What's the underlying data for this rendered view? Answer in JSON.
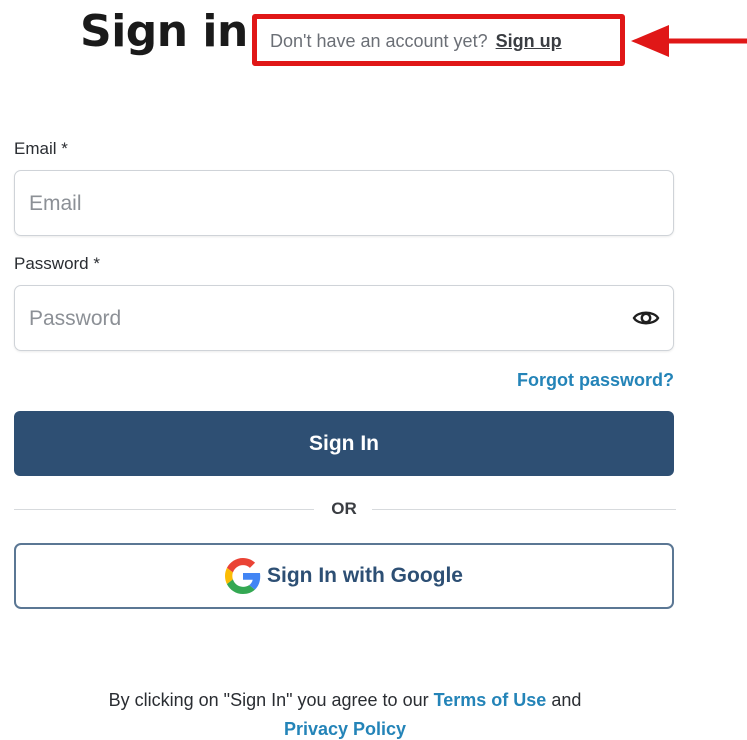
{
  "header": {
    "title": "Sign in",
    "signup_prompt": "Don't have an account yet?",
    "signup_link": "Sign up"
  },
  "annotation": {
    "box_color": "#e01717",
    "arrow_color": "#e01717"
  },
  "form": {
    "email": {
      "label": "Email *",
      "placeholder": "Email",
      "value": ""
    },
    "password": {
      "label": "Password *",
      "placeholder": "Password",
      "value": "",
      "toggle_icon": "eye-icon"
    },
    "forgot_password": "Forgot password?",
    "submit_label": "Sign In",
    "divider_text": "OR",
    "google_label": "Sign In with Google",
    "google_icon": "google-g-icon"
  },
  "legal": {
    "prefix": "By clicking on \"Sign In\" you agree to our",
    "terms_link": "Terms of Use",
    "conjunction": "and",
    "privacy_link": "Privacy Policy"
  },
  "colors": {
    "primary": "#2e4f73",
    "link": "#2484b8",
    "google_border": "#5b7794"
  }
}
